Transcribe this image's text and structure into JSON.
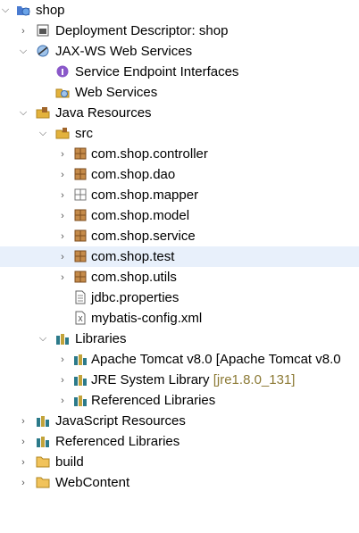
{
  "tree": {
    "root": {
      "label": "shop",
      "icon": "web-project-icon",
      "expanded": true
    },
    "deployment_descriptor": {
      "label": "Deployment Descriptor: shop",
      "icon": "deployment-descriptor-icon",
      "expanded": false
    },
    "jaxws": {
      "label": "JAX-WS Web Services",
      "icon": "web-services-icon",
      "expanded": true
    },
    "service_endpoint_interfaces": {
      "label": "Service Endpoint Interfaces",
      "icon": "endpoint-interface-icon"
    },
    "web_services": {
      "label": "Web Services",
      "icon": "web-service-icon"
    },
    "java_resources": {
      "label": "Java Resources",
      "icon": "java-resources-icon",
      "expanded": true
    },
    "src": {
      "label": "src",
      "icon": "source-folder-icon",
      "expanded": true
    },
    "packages": [
      {
        "label": "com.shop.controller",
        "icon": "package-icon",
        "expanded": false
      },
      {
        "label": "com.shop.dao",
        "icon": "package-icon",
        "expanded": false
      },
      {
        "label": "com.shop.mapper",
        "icon": "empty-package-icon",
        "expanded": false
      },
      {
        "label": "com.shop.model",
        "icon": "package-icon",
        "expanded": false
      },
      {
        "label": "com.shop.service",
        "icon": "package-icon",
        "expanded": false
      },
      {
        "label": "com.shop.test",
        "icon": "package-icon",
        "expanded": false,
        "selected": true
      },
      {
        "label": "com.shop.utils",
        "icon": "package-icon",
        "expanded": false
      }
    ],
    "files": [
      {
        "label": "jdbc.properties",
        "icon": "properties-file-icon"
      },
      {
        "label": "mybatis-config.xml",
        "icon": "xml-file-icon"
      }
    ],
    "libraries": {
      "label": "Libraries",
      "icon": "libraries-icon",
      "expanded": true
    },
    "library_items": [
      {
        "label": "Apache Tomcat v8.0 [Apache Tomcat v8.0",
        "decoration": "",
        "icon": "library-icon"
      },
      {
        "label": "JRE System Library",
        "decoration": "[jre1.8.0_131]",
        "icon": "library-icon"
      },
      {
        "label": "Referenced Libraries",
        "decoration": "",
        "icon": "library-icon"
      }
    ],
    "javascript_resources": {
      "label": "JavaScript Resources",
      "icon": "javascript-resources-icon"
    },
    "referenced_libraries": {
      "label": "Referenced Libraries",
      "icon": "libraries-icon"
    },
    "build": {
      "label": "build",
      "icon": "folder-icon"
    },
    "webcontent": {
      "label": "WebContent",
      "icon": "folder-icon"
    }
  },
  "colors": {
    "package": "#a0652a",
    "library": "#2c7a8a",
    "folder": "#e3b23c",
    "selection": "#e8f0fb",
    "decoration": "#8c7a35"
  }
}
